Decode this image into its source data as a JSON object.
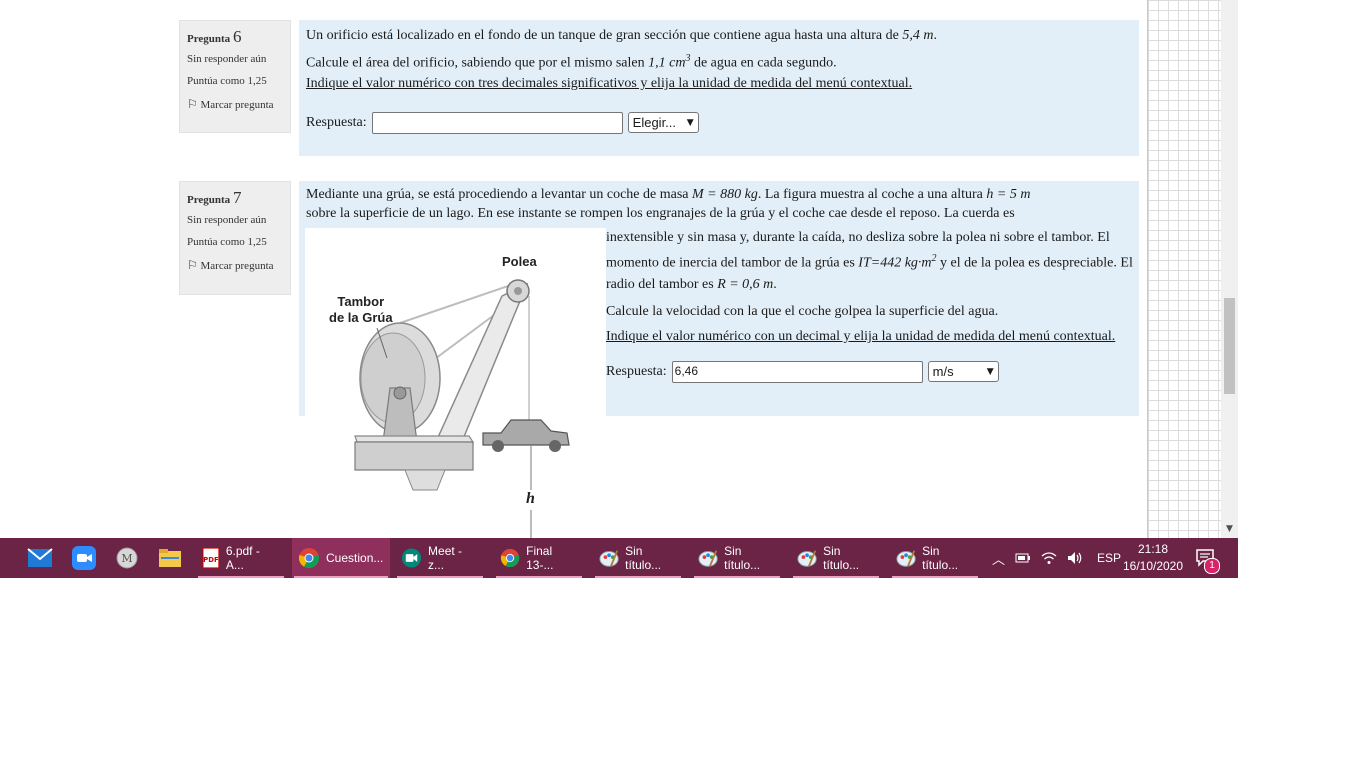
{
  "q6": {
    "label": "Pregunta",
    "number": "6",
    "status": "Sin responder aún",
    "score": "Puntúa como 1,25",
    "flag": "Marcar pregunta",
    "text1_pre": "Un orificio está localizado en el fondo de un tanque de gran sección que contiene agua hasta una altura de ",
    "text1_val": "5,4 m",
    "text1_post": ".",
    "text2_pre": "Calcule el área del orificio, sabiendo que por el mismo salen ",
    "text2_val": "1,1  cm",
    "text2_sup": "3",
    "text2_post": " de agua en cada segundo.",
    "instruction": "Indique el valor numérico con tres decimales significativos y elija la unidad de medida del menú contextual.",
    "answer_label": "Respuesta:",
    "answer_value": "",
    "unit_selected": "Elegir..."
  },
  "q7": {
    "label": "Pregunta",
    "number": "7",
    "status": "Sin responder aún",
    "score": "Puntúa como 1,25",
    "flag": "Marcar pregunta",
    "p1_a": "Mediante una grúa, se está procediendo a levantar un coche de masa ",
    "p1_mass": "M = 880 kg",
    "p1_b": ". La figura muestra al coche a una altura ",
    "p1_height": "h = 5 m",
    "p1_c": "sobre la superficie de un lago. En ese instante se rompen los engranajes de la grúa y el coche cae desde el reposo. La cuerda es",
    "p2_a": "inextensible y sin masa y, durante la caída, no desliza sobre la polea ni sobre el tambor. El momento de inercia del tambor de la grúa es ",
    "p2_inertia": "IT=442 kg·m",
    "p2_sup": "2",
    "p2_b": " y el de la polea es despreciable. El radio del tambor es ",
    "p2_radius": "R = 0,6 m",
    "p2_c": ".",
    "question": "Calcule la velocidad con la que el coche golpea la superficie del agua.",
    "instruction": "Indique el valor numérico con un decimal y elija la unidad de medida del menú contextual.",
    "answer_label": "Respuesta:",
    "answer_value": "6,46",
    "unit_selected": "m/s",
    "figure": {
      "pulley_label": "Polea",
      "drum_label_1": "Tambor",
      "drum_label_2": "de la Grúa",
      "h_label": "h"
    }
  },
  "taskbar": {
    "apps": [
      {
        "icon": "mail-icon"
      },
      {
        "icon": "zoom-icon"
      },
      {
        "icon": "app-m-icon"
      },
      {
        "icon": "file-explorer-icon"
      }
    ],
    "windows": [
      {
        "label": "6.pdf - A...",
        "icon": "pdf-icon"
      },
      {
        "label": "Cuestion...",
        "icon": "chrome-icon"
      },
      {
        "label": "Meet - z...",
        "icon": "meet-icon"
      },
      {
        "label": "Final 13-...",
        "icon": "chrome-icon"
      },
      {
        "label": "Sin título...",
        "icon": "paint-icon"
      },
      {
        "label": "Sin título...",
        "icon": "paint-icon"
      },
      {
        "label": "Sin título...",
        "icon": "paint-icon"
      },
      {
        "label": "Sin título...",
        "icon": "paint-icon"
      }
    ],
    "language": "ESP",
    "time": "21:18",
    "date": "16/10/2020",
    "notifications": "1"
  }
}
